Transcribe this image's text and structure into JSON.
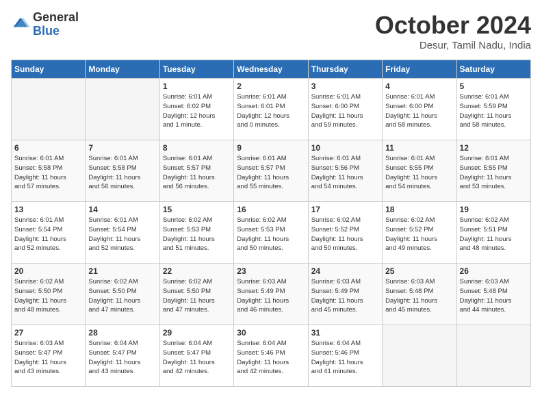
{
  "header": {
    "logo_general": "General",
    "logo_blue": "Blue",
    "month_title": "October 2024",
    "location": "Desur, Tamil Nadu, India"
  },
  "weekdays": [
    "Sunday",
    "Monday",
    "Tuesday",
    "Wednesday",
    "Thursday",
    "Friday",
    "Saturday"
  ],
  "weeks": [
    [
      {
        "day": "",
        "info": ""
      },
      {
        "day": "",
        "info": ""
      },
      {
        "day": "1",
        "info": "Sunrise: 6:01 AM\nSunset: 6:02 PM\nDaylight: 12 hours\nand 1 minute."
      },
      {
        "day": "2",
        "info": "Sunrise: 6:01 AM\nSunset: 6:01 PM\nDaylight: 12 hours\nand 0 minutes."
      },
      {
        "day": "3",
        "info": "Sunrise: 6:01 AM\nSunset: 6:00 PM\nDaylight: 11 hours\nand 59 minutes."
      },
      {
        "day": "4",
        "info": "Sunrise: 6:01 AM\nSunset: 6:00 PM\nDaylight: 11 hours\nand 58 minutes."
      },
      {
        "day": "5",
        "info": "Sunrise: 6:01 AM\nSunset: 5:59 PM\nDaylight: 11 hours\nand 58 minutes."
      }
    ],
    [
      {
        "day": "6",
        "info": "Sunrise: 6:01 AM\nSunset: 5:58 PM\nDaylight: 11 hours\nand 57 minutes."
      },
      {
        "day": "7",
        "info": "Sunrise: 6:01 AM\nSunset: 5:58 PM\nDaylight: 11 hours\nand 56 minutes."
      },
      {
        "day": "8",
        "info": "Sunrise: 6:01 AM\nSunset: 5:57 PM\nDaylight: 11 hours\nand 56 minutes."
      },
      {
        "day": "9",
        "info": "Sunrise: 6:01 AM\nSunset: 5:57 PM\nDaylight: 11 hours\nand 55 minutes."
      },
      {
        "day": "10",
        "info": "Sunrise: 6:01 AM\nSunset: 5:56 PM\nDaylight: 11 hours\nand 54 minutes."
      },
      {
        "day": "11",
        "info": "Sunrise: 6:01 AM\nSunset: 5:55 PM\nDaylight: 11 hours\nand 54 minutes."
      },
      {
        "day": "12",
        "info": "Sunrise: 6:01 AM\nSunset: 5:55 PM\nDaylight: 11 hours\nand 53 minutes."
      }
    ],
    [
      {
        "day": "13",
        "info": "Sunrise: 6:01 AM\nSunset: 5:54 PM\nDaylight: 11 hours\nand 52 minutes."
      },
      {
        "day": "14",
        "info": "Sunrise: 6:01 AM\nSunset: 5:54 PM\nDaylight: 11 hours\nand 52 minutes."
      },
      {
        "day": "15",
        "info": "Sunrise: 6:02 AM\nSunset: 5:53 PM\nDaylight: 11 hours\nand 51 minutes."
      },
      {
        "day": "16",
        "info": "Sunrise: 6:02 AM\nSunset: 5:53 PM\nDaylight: 11 hours\nand 50 minutes."
      },
      {
        "day": "17",
        "info": "Sunrise: 6:02 AM\nSunset: 5:52 PM\nDaylight: 11 hours\nand 50 minutes."
      },
      {
        "day": "18",
        "info": "Sunrise: 6:02 AM\nSunset: 5:52 PM\nDaylight: 11 hours\nand 49 minutes."
      },
      {
        "day": "19",
        "info": "Sunrise: 6:02 AM\nSunset: 5:51 PM\nDaylight: 11 hours\nand 48 minutes."
      }
    ],
    [
      {
        "day": "20",
        "info": "Sunrise: 6:02 AM\nSunset: 5:50 PM\nDaylight: 11 hours\nand 48 minutes."
      },
      {
        "day": "21",
        "info": "Sunrise: 6:02 AM\nSunset: 5:50 PM\nDaylight: 11 hours\nand 47 minutes."
      },
      {
        "day": "22",
        "info": "Sunrise: 6:02 AM\nSunset: 5:50 PM\nDaylight: 11 hours\nand 47 minutes."
      },
      {
        "day": "23",
        "info": "Sunrise: 6:03 AM\nSunset: 5:49 PM\nDaylight: 11 hours\nand 46 minutes."
      },
      {
        "day": "24",
        "info": "Sunrise: 6:03 AM\nSunset: 5:49 PM\nDaylight: 11 hours\nand 45 minutes."
      },
      {
        "day": "25",
        "info": "Sunrise: 6:03 AM\nSunset: 5:48 PM\nDaylight: 11 hours\nand 45 minutes."
      },
      {
        "day": "26",
        "info": "Sunrise: 6:03 AM\nSunset: 5:48 PM\nDaylight: 11 hours\nand 44 minutes."
      }
    ],
    [
      {
        "day": "27",
        "info": "Sunrise: 6:03 AM\nSunset: 5:47 PM\nDaylight: 11 hours\nand 43 minutes."
      },
      {
        "day": "28",
        "info": "Sunrise: 6:04 AM\nSunset: 5:47 PM\nDaylight: 11 hours\nand 43 minutes."
      },
      {
        "day": "29",
        "info": "Sunrise: 6:04 AM\nSunset: 5:47 PM\nDaylight: 11 hours\nand 42 minutes."
      },
      {
        "day": "30",
        "info": "Sunrise: 6:04 AM\nSunset: 5:46 PM\nDaylight: 11 hours\nand 42 minutes."
      },
      {
        "day": "31",
        "info": "Sunrise: 6:04 AM\nSunset: 5:46 PM\nDaylight: 11 hours\nand 41 minutes."
      },
      {
        "day": "",
        "info": ""
      },
      {
        "day": "",
        "info": ""
      }
    ]
  ]
}
